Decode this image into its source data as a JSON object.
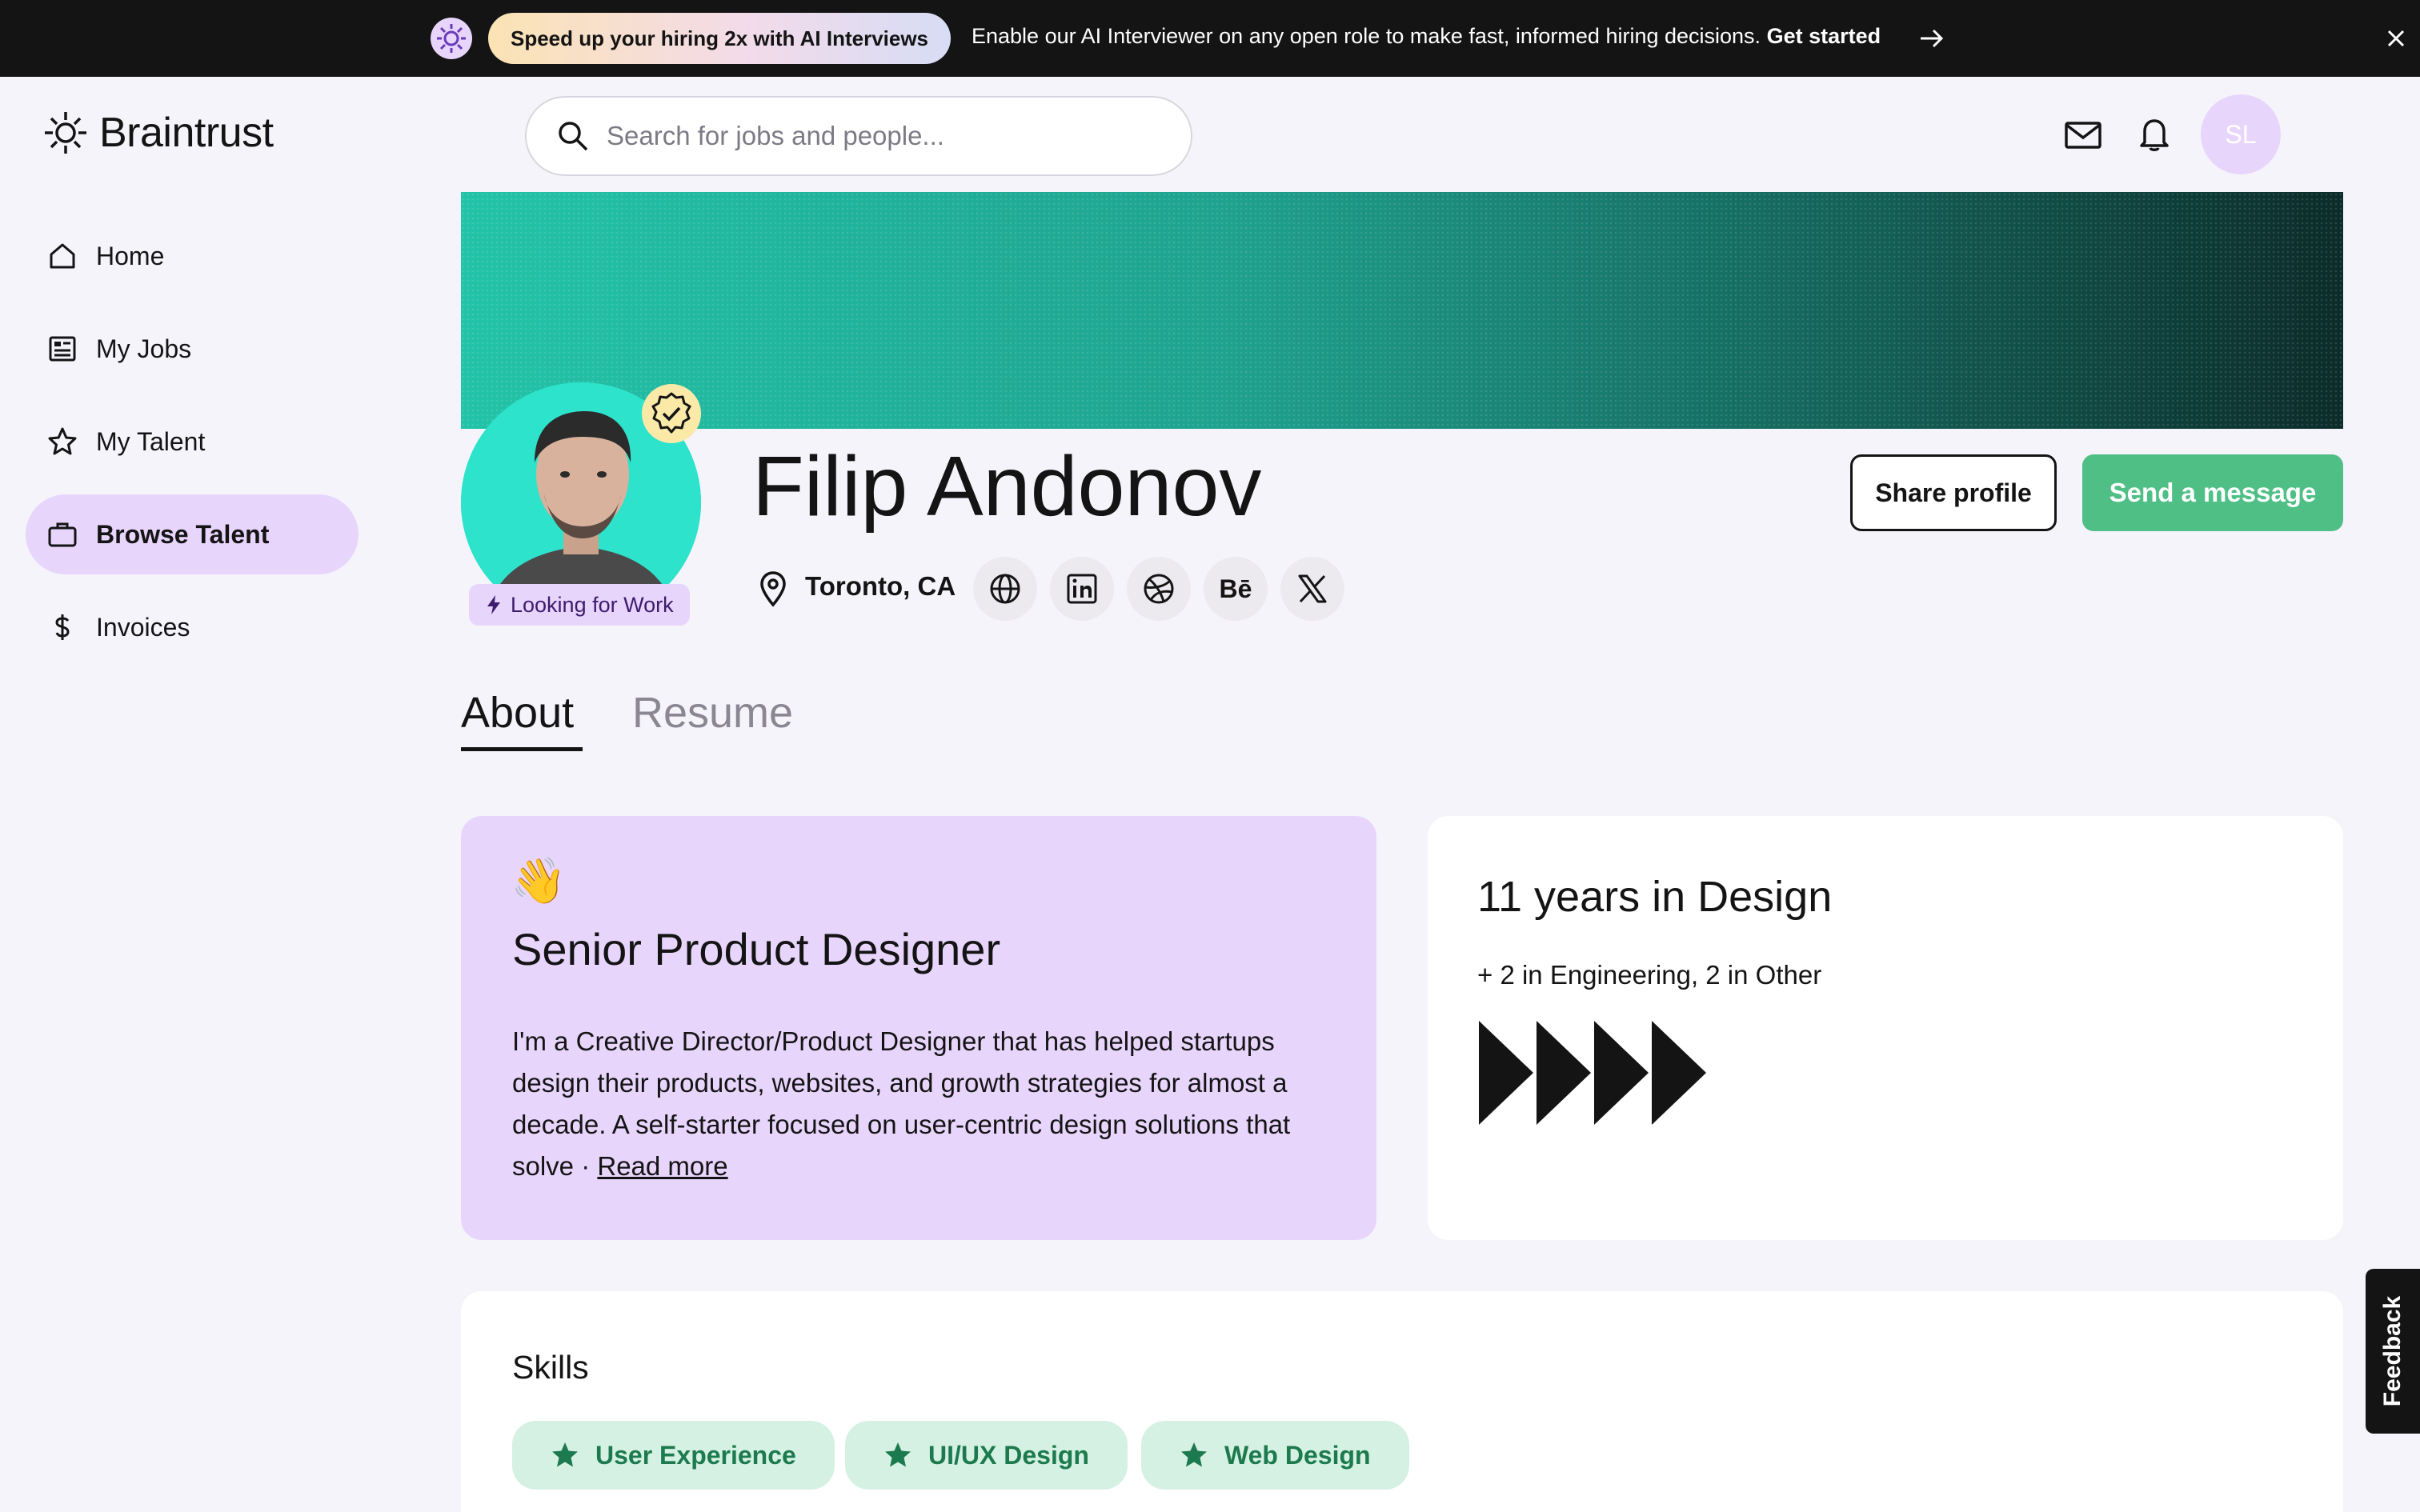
{
  "banner": {
    "pill_text": "Speed up your hiring 2x with AI Interviews",
    "message": "Enable our AI Interviewer on any open role to make fast, informed hiring decisions.",
    "cta": "Get started"
  },
  "brand": {
    "name": "Braintrust"
  },
  "sidebar": {
    "items": [
      {
        "label": "Home",
        "icon": "home-icon"
      },
      {
        "label": "My Jobs",
        "icon": "jobs-icon"
      },
      {
        "label": "My Talent",
        "icon": "star-icon"
      },
      {
        "label": "Browse Talent",
        "icon": "briefcase-icon",
        "active": true
      },
      {
        "label": "Invoices",
        "icon": "dollar-icon"
      }
    ]
  },
  "search": {
    "placeholder": "Search for jobs and people..."
  },
  "user": {
    "initials": "SL"
  },
  "profile": {
    "name": "Filip Andonov",
    "status": "Looking for Work",
    "location": "Toronto, CA",
    "socials": [
      "website",
      "linkedin",
      "dribbble",
      "behance",
      "x"
    ],
    "share_label": "Share profile",
    "message_label": "Send a message"
  },
  "tabs": [
    "About",
    "Resume"
  ],
  "about": {
    "emoji": "👋",
    "role": "Senior Product Designer",
    "bio": "I'm a Creative Director/Product Designer that has helped startups design their products, websites, and growth strategies for almost a decade. A self-starter focused on user-centric design solutions that solve · ",
    "read_more": "Read more"
  },
  "experience": {
    "title": "11 years in Design",
    "subtitle": "+ 2 in Engineering, 2 in Other"
  },
  "skills": {
    "title": "Skills",
    "items": [
      "User Experience",
      "UI/UX Design",
      "Web Design"
    ]
  },
  "feedback_label": "Feedback",
  "colors": {
    "accent_purple": "#e8d5fc",
    "accent_green": "#4fbf86",
    "skill_green": "#1d7a4e"
  }
}
